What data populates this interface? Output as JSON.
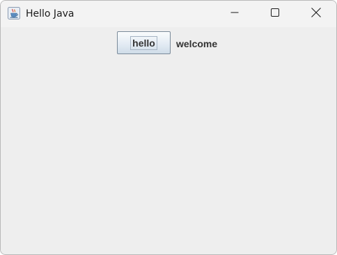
{
  "window": {
    "title": "Hello Java",
    "app_icon": "java-cup-icon",
    "controls": [
      "minimize-icon",
      "maximize-icon",
      "close-icon"
    ]
  },
  "content": {
    "button_label": "hello",
    "label_text": "welcome"
  }
}
